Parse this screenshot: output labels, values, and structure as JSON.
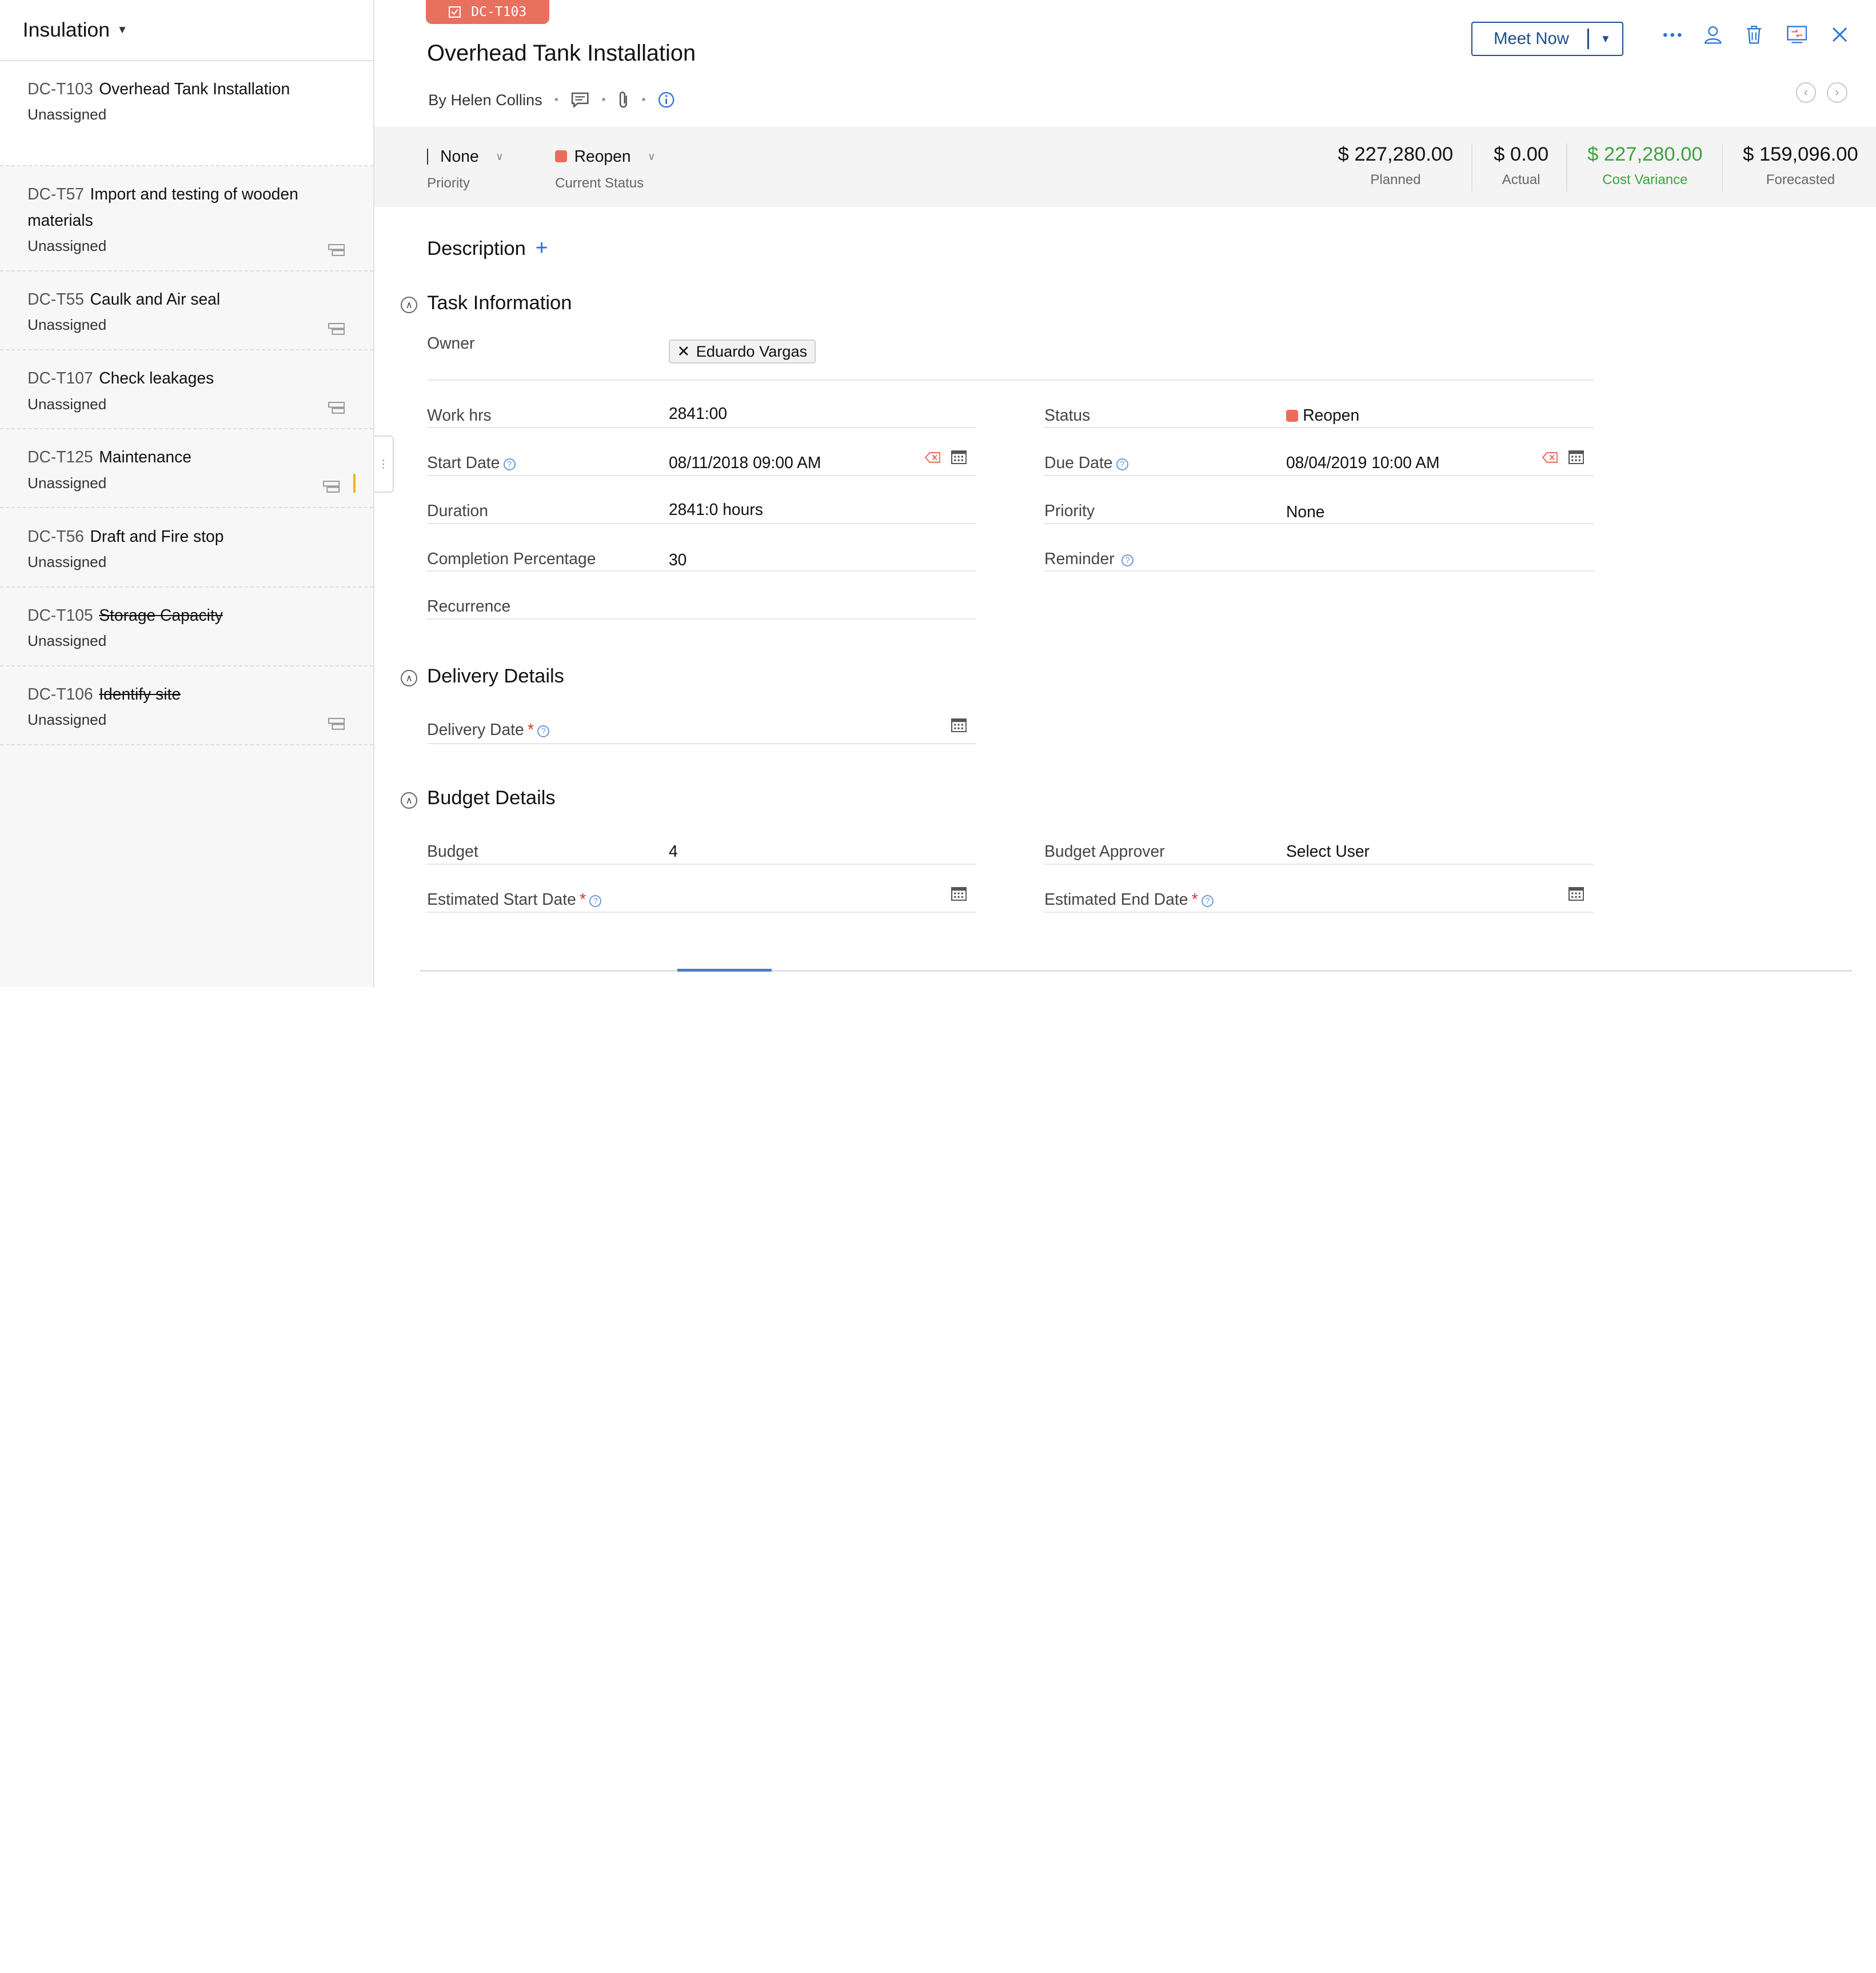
{
  "sidebar": {
    "project_name": "Insulation",
    "tasks": [
      {
        "id": "DC-T103",
        "title": "Overhead Tank Installation",
        "assignee": "Unassigned",
        "strike": false
      },
      {
        "id": "DC-T57",
        "title": "Import and testing of wooden materials",
        "assignee": "Unassigned",
        "strike": false
      },
      {
        "id": "DC-T55",
        "title": "Caulk and Air seal",
        "assignee": "Unassigned",
        "strike": false
      },
      {
        "id": "DC-T107",
        "title": "Check leakages",
        "assignee": "Unassigned",
        "strike": false
      },
      {
        "id": "DC-T125",
        "title": "Maintenance",
        "assignee": "Unassigned",
        "strike": false
      },
      {
        "id": "DC-T56",
        "title": "Draft and Fire stop",
        "assignee": "Unassigned",
        "strike": false
      },
      {
        "id": "DC-T105",
        "title": "Storage Capacity",
        "assignee": "Unassigned",
        "strike": true
      },
      {
        "id": "DC-T106",
        "title": "Identify site",
        "assignee": "Unassigned",
        "strike": true
      }
    ]
  },
  "header": {
    "task_tag": "DC-T103",
    "title": "Overhead Tank Installation",
    "byline": "By Helen Collins",
    "meet_now": "Meet Now"
  },
  "summary": {
    "priority_value": "None",
    "priority_label": "Priority",
    "status_value": "Reopen",
    "status_label": "Current Status",
    "status_color": "#ea6d5a",
    "planned_amount": "$ 227,280.00",
    "planned_label": "Planned",
    "actual_amount": "$ 0.00",
    "actual_label": "Actual",
    "variance_amount": "$ 227,280.00",
    "variance_label": "Cost Variance",
    "forecast_amount": "$ 159,096.00",
    "forecast_label": "Forecasted"
  },
  "description": {
    "title": "Description",
    "add": "+"
  },
  "task_info": {
    "title": "Task Information",
    "owner_label": "Owner",
    "owner_value": "Eduardo Vargas",
    "work_hrs_label": "Work hrs",
    "work_hrs_value": "2841:00",
    "status_label": "Status",
    "status_value": "Reopen",
    "start_date_label": "Start Date",
    "start_date_value": "08/11/2018 09:00 AM",
    "due_date_label": "Due Date",
    "due_date_value": "08/04/2019 10:00 AM",
    "duration_label": "Duration",
    "duration_value": "2841:0 hours",
    "priority_label": "Priority",
    "priority_value": "None",
    "completion_label": "Completion Percentage",
    "completion_value": "30",
    "reminder_label": "Reminder",
    "recurrence_label": "Recurrence"
  },
  "delivery": {
    "title": "Delivery Details",
    "delivery_date_label": "Delivery Date"
  },
  "budget": {
    "title": "Budget Details",
    "budget_label": "Budget",
    "budget_value": "4",
    "approver_label": "Budget Approver",
    "approver_value": "Select User",
    "est_start_label": "Estimated Start Date",
    "est_end_label": "Estimated End Date"
  },
  "icons": {
    "more": "more-icon",
    "assign": "user-icon",
    "delete": "trash-icon",
    "convert": "convert-icon",
    "close": "close-icon"
  },
  "colors": {
    "accent": "#1e4e8c",
    "tag": "#e8705f",
    "variance_green": "#3fa23f",
    "status_reopen": "#ea6d5a"
  }
}
